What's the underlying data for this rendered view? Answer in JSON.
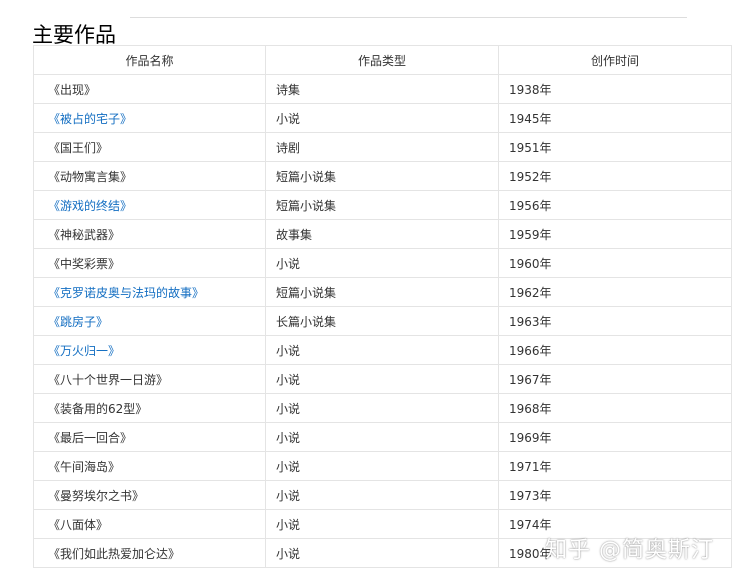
{
  "section": {
    "title": "主要作品"
  },
  "table": {
    "headers": [
      "作品名称",
      "作品类型",
      "创作时间"
    ],
    "rows": [
      {
        "title": "《出现》",
        "type": "诗集",
        "year": "1938年",
        "link": false
      },
      {
        "title": "《被占的宅子》",
        "type": "小说",
        "year": "1945年",
        "link": true
      },
      {
        "title": "《国王们》",
        "type": "诗剧",
        "year": "1951年",
        "link": false
      },
      {
        "title": "《动物寓言集》",
        "type": "短篇小说集",
        "year": "1952年",
        "link": false
      },
      {
        "title": "《游戏的终结》",
        "type": "短篇小说集",
        "year": "1956年",
        "link": true
      },
      {
        "title": "《神秘武器》",
        "type": "故事集",
        "year": "1959年",
        "link": false
      },
      {
        "title": "《中奖彩票》",
        "type": "小说",
        "year": "1960年",
        "link": false
      },
      {
        "title": "《克罗诺皮奥与法玛的故事》",
        "type": "短篇小说集",
        "year": "1962年",
        "link": true
      },
      {
        "title": "《跳房子》",
        "type": "长篇小说集",
        "year": "1963年",
        "link": true
      },
      {
        "title": "《万火归一》",
        "type": "小说",
        "year": "1966年",
        "link": true
      },
      {
        "title": "《八十个世界一日游》",
        "type": "小说",
        "year": "1967年",
        "link": false
      },
      {
        "title": "《装备用的62型》",
        "type": "小说",
        "year": "1968年",
        "link": false
      },
      {
        "title": "《最后一回合》",
        "type": "小说",
        "year": "1969年",
        "link": false
      },
      {
        "title": "《午间海岛》",
        "type": "小说",
        "year": "1971年",
        "link": false
      },
      {
        "title": "《曼努埃尔之书》",
        "type": "小说",
        "year": "1973年",
        "link": false
      },
      {
        "title": "《八面体》",
        "type": "小说",
        "year": "1974年",
        "link": false
      },
      {
        "title": "《我们如此热爱加仑达》",
        "type": "小说",
        "year": "1980年",
        "link": false
      }
    ]
  },
  "watermark": {
    "text": "知乎 @简奥斯汀"
  },
  "colors": {
    "link": "#136ec2",
    "text": "#333333",
    "border": "#e4e4e4"
  }
}
